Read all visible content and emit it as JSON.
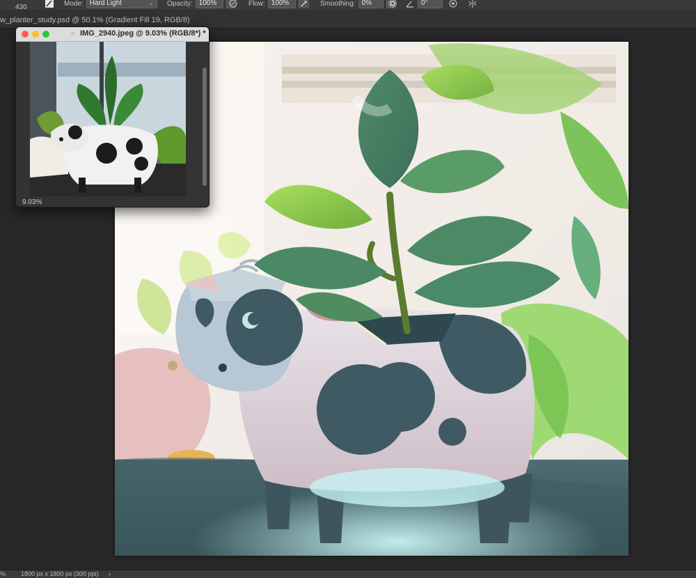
{
  "options_bar": {
    "brush_size": "430",
    "mode_label": "Mode:",
    "mode_value": "Hard Light",
    "opacity_label": "Opacity:",
    "opacity_value": "100%",
    "flow_label": "Flow:",
    "flow_value": "100%",
    "smoothing_label": "Smoothing:",
    "smoothing_value": "0%",
    "angle_value": "0°",
    "icons": [
      "brush-preset-icon",
      "pressure-opacity-icon",
      "airbrush-icon",
      "smoothing-settings-icon",
      "angle-icon",
      "pressure-size-icon",
      "symmetry-icon"
    ]
  },
  "doc_tabs": {
    "active": "w_planter_study.psd @ 50.1% (Gradient Fill 19, RGB/8)"
  },
  "ref_window": {
    "title": "IMG_2940.jpeg @ 9.03% (RGB/8*) *",
    "zoom": "9.03%"
  },
  "status_bar": {
    "zoom": "%",
    "dimensions": "1800 px x 1800 px (300 ppi)",
    "arrow": "›"
  },
  "colors": {
    "app_bg": "#282828",
    "panel_bg": "#3a3a3a",
    "close": "#fd5f57",
    "minimize": "#febc2e",
    "maximize": "#28c840"
  }
}
